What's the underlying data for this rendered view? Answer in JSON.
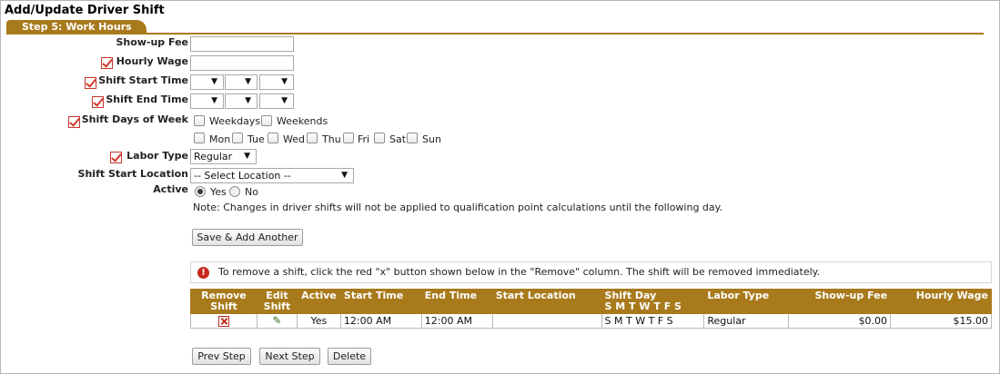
{
  "page": {
    "title": "Add/Update Driver Shift",
    "step_tab": "Step 5: Work Hours"
  },
  "form": {
    "show_up_fee": {
      "label": "Show-up Fee",
      "value": ""
    },
    "hourly_wage": {
      "label": "Hourly Wage",
      "value": ""
    },
    "shift_start_time": {
      "label": "Shift Start Time",
      "hour": "",
      "minute": "",
      "ampm": ""
    },
    "shift_end_time": {
      "label": "Shift End Time",
      "hour": "",
      "minute": "",
      "ampm": ""
    },
    "shift_days": {
      "label": "Shift Days of Week",
      "groups": [
        "Weekdays",
        "Weekends"
      ],
      "days": [
        "Mon",
        "Tue",
        "Wed",
        "Thu",
        "Fri",
        "Sat",
        "Sun"
      ]
    },
    "labor_type": {
      "label": "Labor Type",
      "selected": "Regular"
    },
    "shift_start_location": {
      "label": "Shift Start Location",
      "selected": "-- Select Location --"
    },
    "active": {
      "label": "Active",
      "options": [
        "Yes",
        "No"
      ],
      "selected": "Yes"
    },
    "note": "Note: Changes in driver shifts will not be applied to qualification point calculations until the following day.",
    "save_add_button": "Save & Add Another"
  },
  "info": {
    "icon": "info-icon",
    "text": "To remove a shift, click the red \"x\" button shown below in the \"Remove\" column. The shift will be removed immediately."
  },
  "table": {
    "headers": {
      "remove": [
        "Remove",
        "Shift"
      ],
      "edit": [
        "Edit",
        "Shift"
      ],
      "active": "Active",
      "start_time": "Start Time",
      "end_time": "End Time",
      "start_location": "Start Location",
      "shift_day": [
        "Shift Day",
        "S M T W T F S"
      ],
      "labor_type": "Labor Type",
      "show_up_fee": "Show-up Fee",
      "hourly_wage": "Hourly Wage"
    },
    "rows": [
      {
        "active": "Yes",
        "start_time": "12:00 AM",
        "end_time": "12:00 AM",
        "start_location": "",
        "shift_day": "S M T W T F S",
        "labor_type": "Regular",
        "show_up_fee": "$0.00",
        "hourly_wage": "$15.00"
      }
    ]
  },
  "nav": {
    "prev": "Prev Step",
    "next": "Next Step",
    "delete": "Delete"
  },
  "colors": {
    "accent": "#a87a1c",
    "required": "#d33b2e",
    "info": "#c5281c"
  }
}
